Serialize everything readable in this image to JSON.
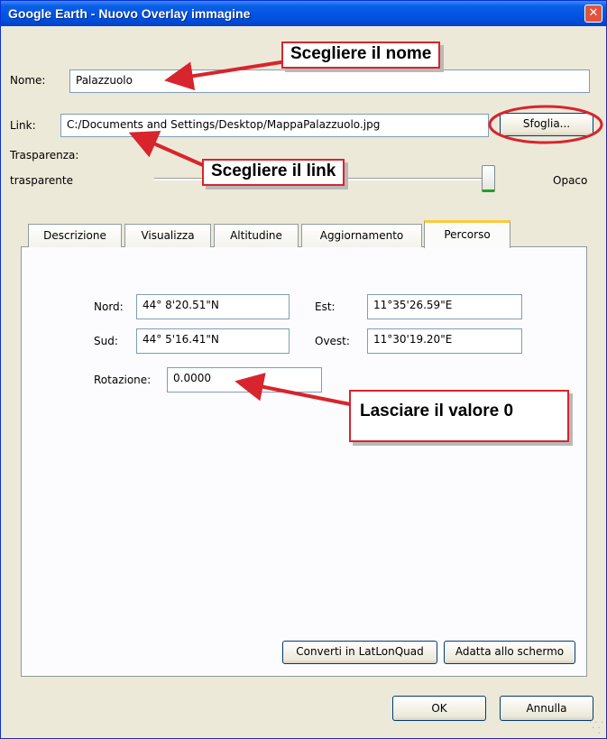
{
  "window": {
    "title": "Google Earth - Nuovo Overlay immagine",
    "close_symbol": "✕"
  },
  "form": {
    "name_label": "Nome:",
    "name_value": "Palazzuolo",
    "link_label": "Link:",
    "link_value": "C:/Documents and Settings/Desktop/MappaPalazzuolo.jpg",
    "browse_label": "Sfoglia...",
    "transparency_label": "Trasparenza:",
    "transparent_label": "trasparente",
    "opaque_label": "Opaco",
    "opacity_level": 1.0
  },
  "tabs": [
    {
      "label": "Descrizione",
      "active": false
    },
    {
      "label": "Visualizza",
      "active": false
    },
    {
      "label": "Altitudine",
      "active": false
    },
    {
      "label": "Aggiornamento",
      "active": false
    },
    {
      "label": "Percorso",
      "active": true
    }
  ],
  "coords": {
    "north_label": "Nord:",
    "north_value": "44° 8'20.51\"N",
    "east_label": "Est:",
    "east_value": "11°35'26.59\"E",
    "south_label": "Sud:",
    "south_value": "44° 5'16.41\"N",
    "west_label": "Ovest:",
    "west_value": "11°30'19.20\"E",
    "rotation_label": "Rotazione:",
    "rotation_value": "0.0000"
  },
  "panel_buttons": {
    "convert_label": "Converti in LatLonQuad",
    "fit_label": "Adatta allo schermo"
  },
  "footer": {
    "ok_label": "OK",
    "cancel_label": "Annulla"
  },
  "annotations": {
    "name_callout": "Scegliere il nome",
    "link_callout": "Scegliere il link",
    "rotation_callout": "Lasciare il valore 0"
  },
  "colors": {
    "title_bar": "#0050e0",
    "annotation": "#d8242c",
    "active_tab_accent": "#ffc83c"
  }
}
